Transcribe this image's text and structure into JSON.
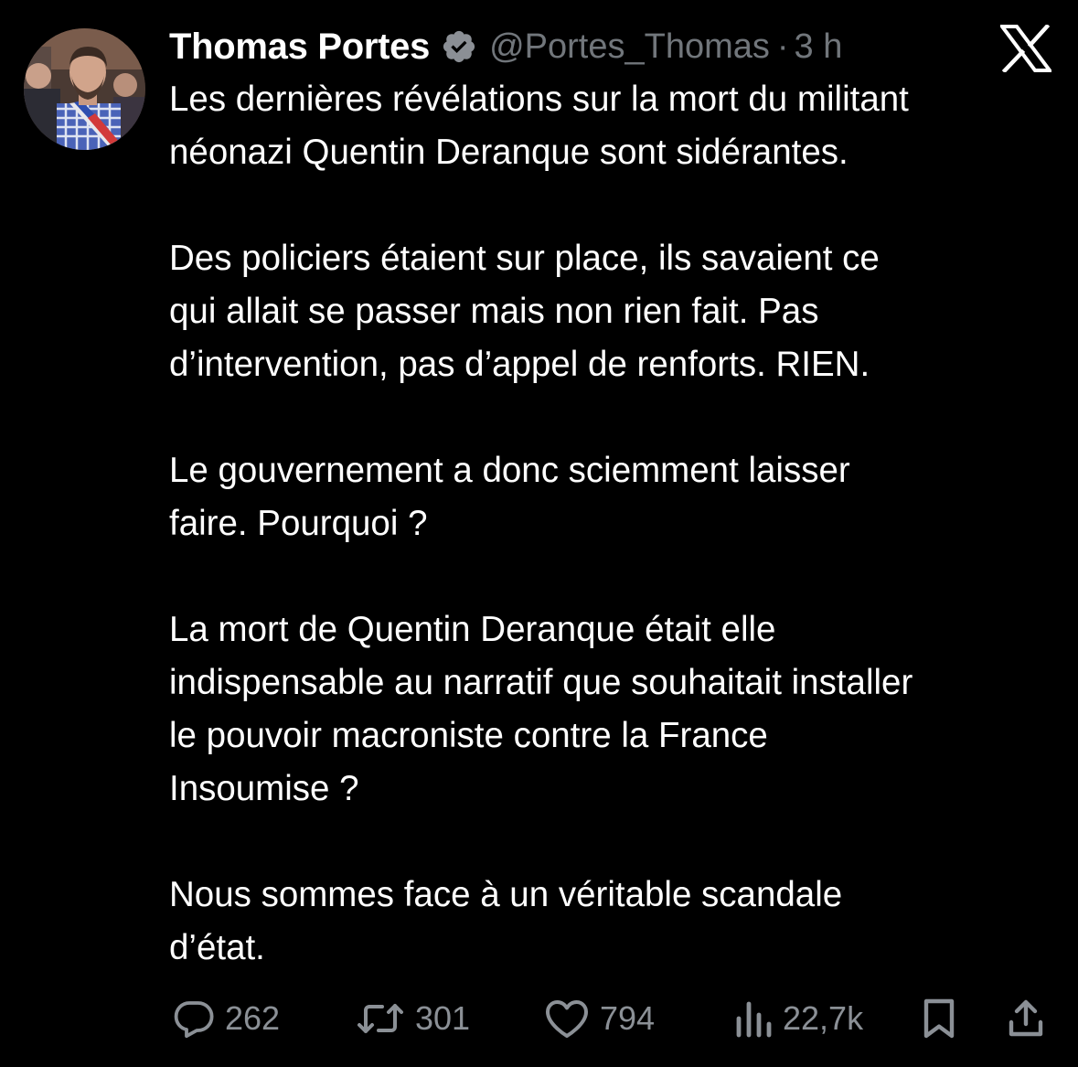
{
  "author": {
    "name": "Thomas Portes",
    "handle": "@Portes_Thomas",
    "separator": "·",
    "time": "3 h",
    "verified_badge_color": "#8b8f95"
  },
  "brand": {
    "logo": "x-logo-icon",
    "color": "#ffffff"
  },
  "tweet": {
    "paragraphs": [
      [
        "Les dernières révélations sur la mort du militant",
        "néonazi Quentin Deranque sont sidérantes."
      ],
      [
        "Des policiers étaient sur place, ils savaient ce",
        "qui allait se passer mais non rien fait. Pas",
        "d’intervention, pas d’appel de renforts. RIEN."
      ],
      [
        "Le gouvernement a donc sciemment laisser",
        "faire. Pourquoi ?"
      ],
      [
        "La mort de Quentin Deranque était elle",
        "indispensable au narratif que souhaitait installer",
        "le pouvoir macroniste contre la France",
        "Insoumise ?"
      ],
      [
        "Nous sommes face à un véritable scandale",
        "d’état."
      ]
    ]
  },
  "actions": {
    "replies": "262",
    "reposts": "301",
    "likes": "794",
    "views": "22,7k"
  },
  "colors": {
    "background": "#000000",
    "text": "#ffffff",
    "muted": "#71767b"
  }
}
